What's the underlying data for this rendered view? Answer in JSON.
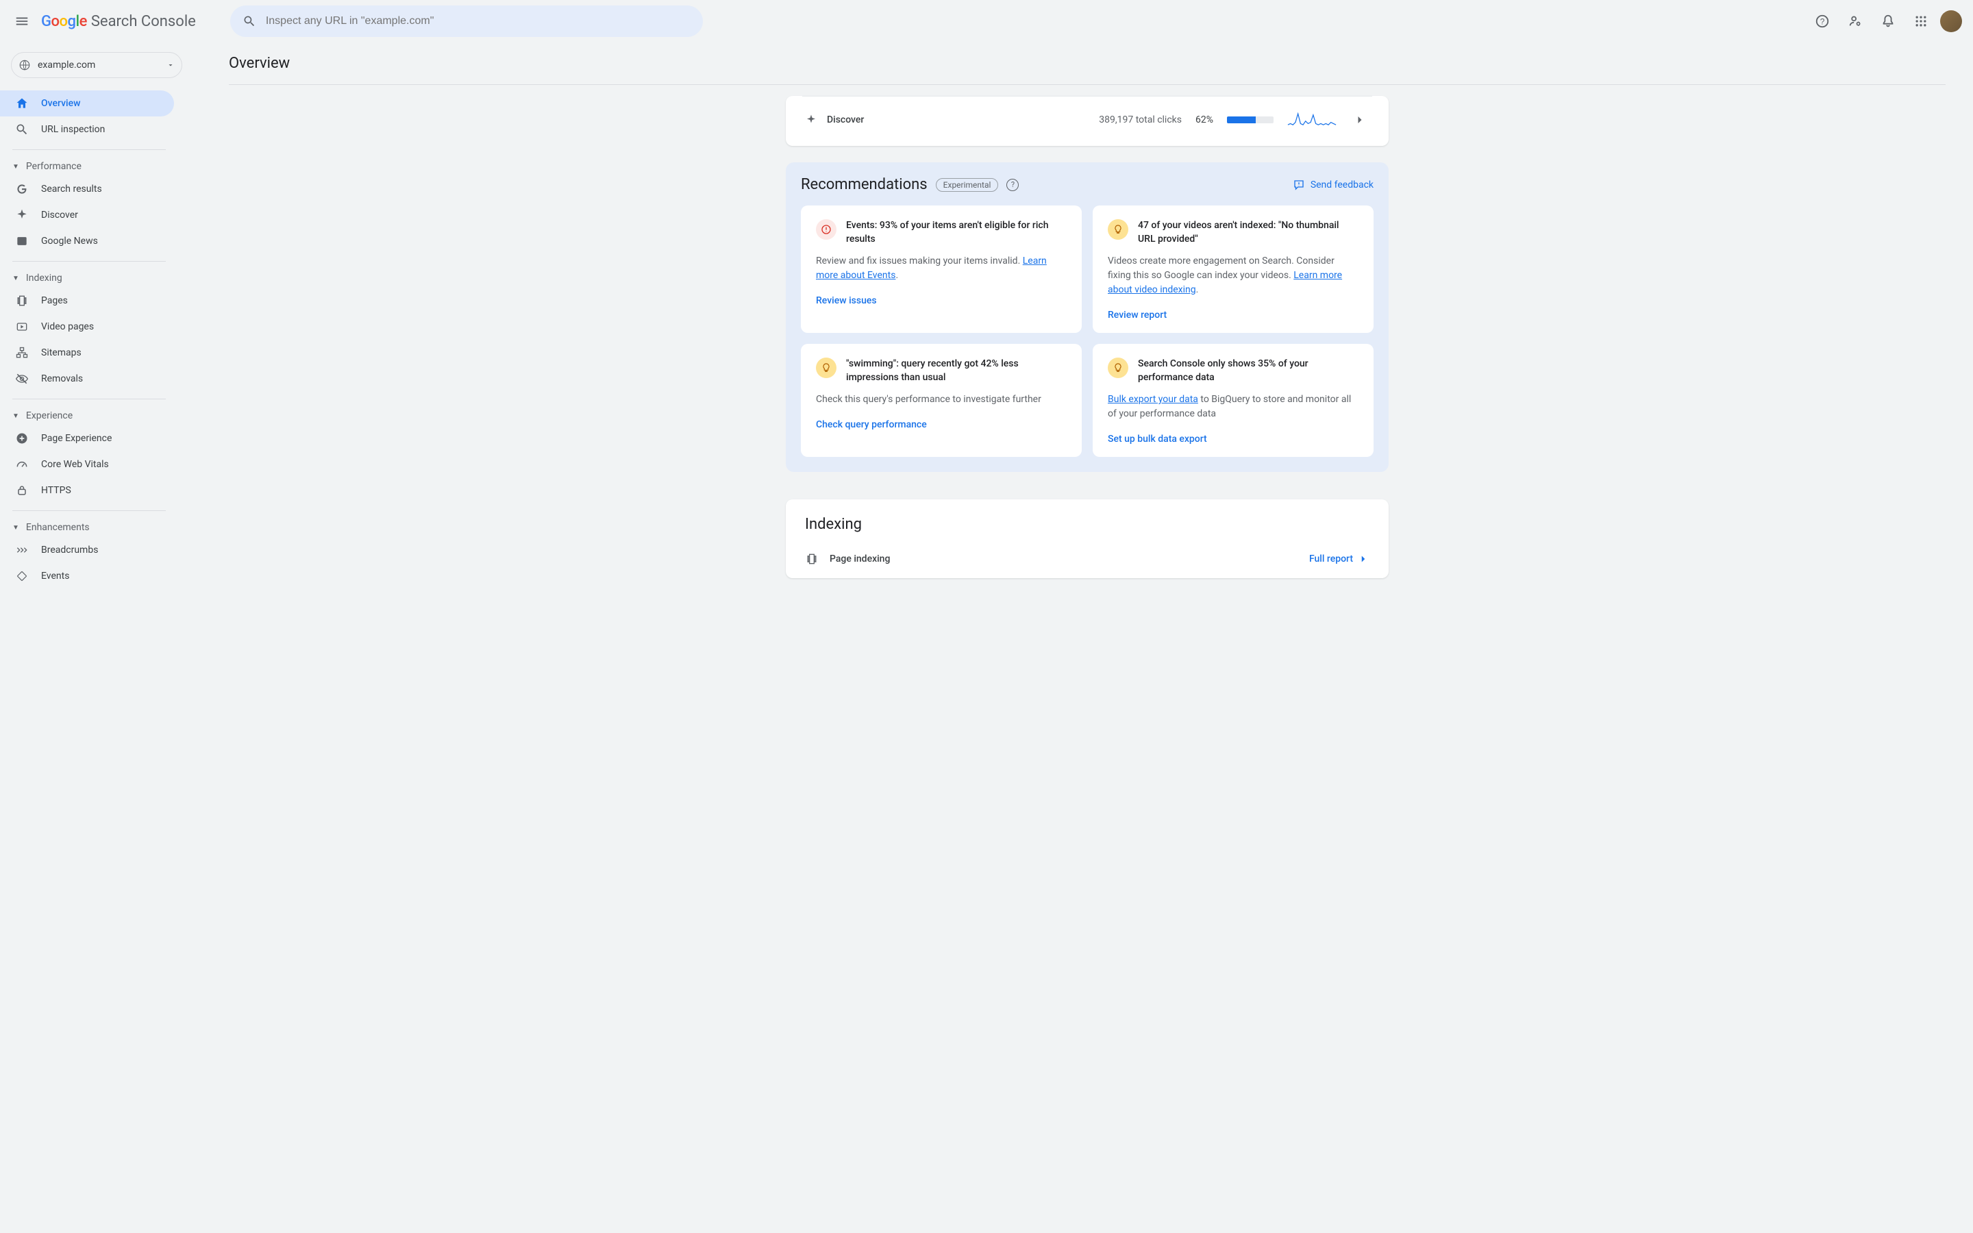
{
  "header": {
    "logo_text": "Google",
    "logo_suffix": "Search Console",
    "search_placeholder": "Inspect any URL in \"example.com\""
  },
  "property": "example.com",
  "page_title": "Overview",
  "sidebar": {
    "items_top": [
      {
        "label": "Overview"
      },
      {
        "label": "URL inspection"
      }
    ],
    "sections": [
      {
        "title": "Performance",
        "items": [
          "Search results",
          "Discover",
          "Google News"
        ]
      },
      {
        "title": "Indexing",
        "items": [
          "Pages",
          "Video pages",
          "Sitemaps",
          "Removals"
        ]
      },
      {
        "title": "Experience",
        "items": [
          "Page Experience",
          "Core Web Vitals",
          "HTTPS"
        ]
      },
      {
        "title": "Enhancements",
        "items": [
          "Breadcrumbs",
          "Events"
        ]
      }
    ]
  },
  "discover": {
    "label": "Discover",
    "clicks_text": "389,197 total clicks",
    "percent_label": "62%",
    "percent_value": 62
  },
  "recommendations": {
    "title": "Recommendations",
    "badge": "Experimental",
    "feedback": "Send feedback",
    "cards": [
      {
        "icon": "red",
        "title": "Events: 93% of your items aren't eligible for rich results",
        "body_pre": "Review and fix issues making your items invalid. ",
        "body_link": "Learn more about Events",
        "body_post": ".",
        "action": "Review issues"
      },
      {
        "icon": "yellow",
        "title": "47 of your videos aren't indexed: \"No thumbnail URL provided\"",
        "body_pre": "Videos create more engagement on Search. Consider fixing this so Google can index your videos. ",
        "body_link": "Learn more about video indexing",
        "body_post": ".",
        "action": "Review report"
      },
      {
        "icon": "yellow",
        "title": "\"swimming\": query recently got 42% less impressions than usual",
        "body_pre": "Check this query's performance to investigate further",
        "body_link": "",
        "body_post": "",
        "action": "Check query performance"
      },
      {
        "icon": "yellow",
        "title": "Search Console only shows 35% of your performance data",
        "body_pre": "",
        "body_link": "Bulk export your data",
        "body_post": " to BigQuery to store and monitor all of your performance data",
        "action": "Set up bulk data export"
      }
    ]
  },
  "indexing": {
    "title": "Indexing",
    "row_label": "Page indexing",
    "full_report": "Full report"
  },
  "chart_data": {
    "type": "line",
    "note": "sparkline in Discover row",
    "values": [
      3,
      4,
      3,
      5,
      12,
      4,
      3,
      6,
      4,
      5,
      11,
      4,
      3,
      4,
      3,
      4,
      3,
      5,
      4,
      3
    ],
    "color": "#1a73e8"
  }
}
